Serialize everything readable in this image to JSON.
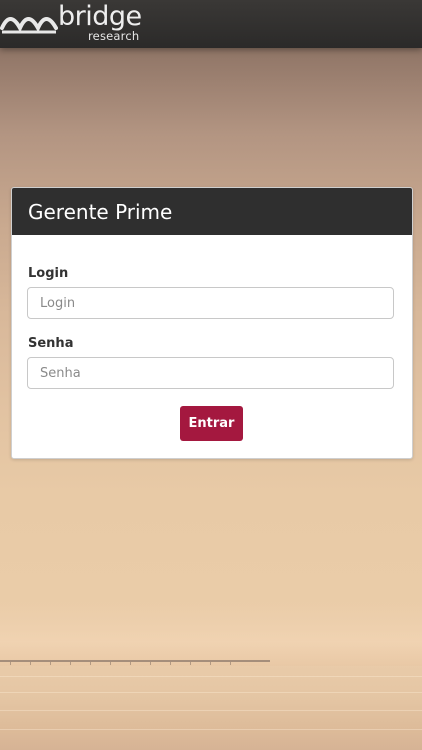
{
  "brand": {
    "word": "bridge",
    "sub": "research",
    "logo_icon": "bridge-arches-icon"
  },
  "card": {
    "title": "Gerente Prime"
  },
  "form": {
    "login_label": "Login",
    "login_placeholder": "Login",
    "senha_label": "Senha",
    "senha_placeholder": "Senha",
    "submit_label": "Entrar"
  },
  "colors": {
    "topbar": "#2b2a29",
    "card_header": "#2f2f2f",
    "button": "#a4183f"
  }
}
